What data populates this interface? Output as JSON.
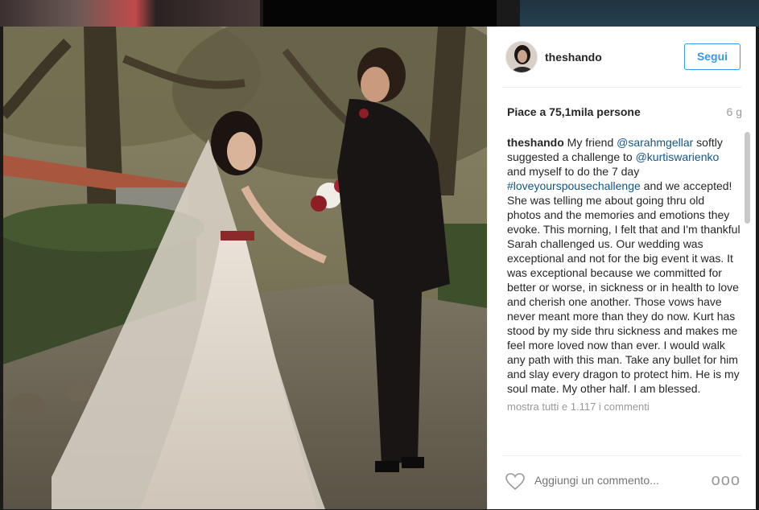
{
  "post": {
    "username": "theshando",
    "follow_label": "Segui",
    "likes": "Piace a 75,1mila persone",
    "time": "6 g",
    "caption": {
      "user": "theshando",
      "t1": " My friend ",
      "tag1": "@sarahmgellar",
      "t2": " softly suggested a challenge to ",
      "tag2": "@kurtiswarienko",
      "t3": " and myself to do the 7 day ",
      "tag3": "#loveyourspousechallenge",
      "t4": " and we accepted! She was telling me about going thru old photos and the memories and emotions they evoke. This morning, I felt that and I'm thankful Sarah challenged us. Our wedding was exceptional and not for the big event it was. It was exceptional because we committed for better or worse, in sickness or in health to love and cherish one another. Those vows have never meant more than they do now. Kurt has stood by my side thru sickness and makes me feel more loved now than ever. I would walk any path with this man. Take any bullet for him and slay every dragon to protect him. He is my soul mate. My other half. I am blessed."
    },
    "more_comments": "mostra tutti e 1.117 i commenti",
    "comment_placeholder": "Aggiungi un commento...",
    "more_options": "ooo"
  },
  "icons": {
    "heart": "heart-outline-icon",
    "more": "more-options-icon"
  },
  "colors": {
    "accent": "#3897f0",
    "link": "#125688",
    "muted": "#999999",
    "text": "#262626"
  }
}
